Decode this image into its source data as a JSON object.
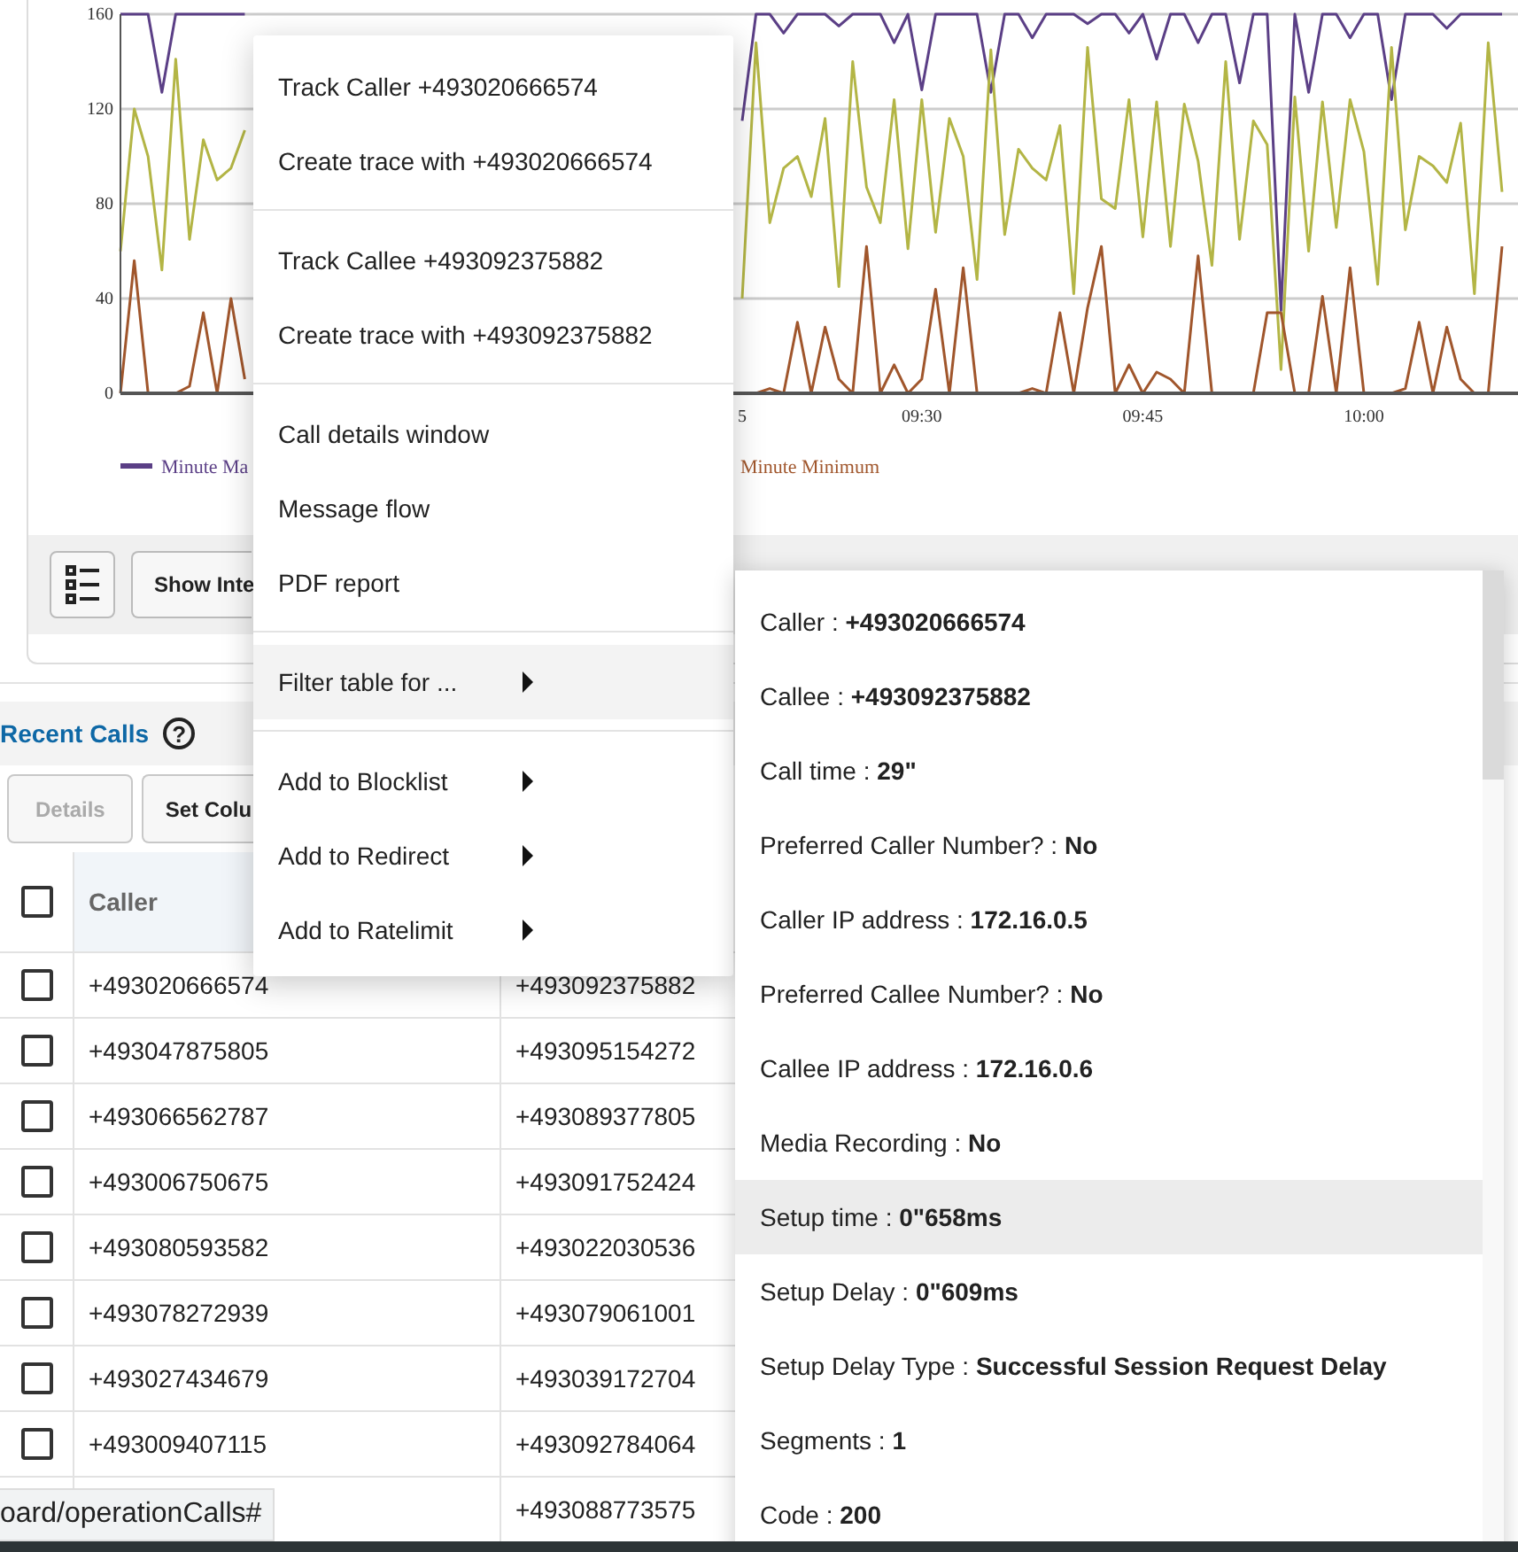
{
  "chart_card": {
    "chart_data": {
      "type": "line",
      "grid": true,
      "ylim": [
        0,
        160
      ],
      "yticks": [
        0,
        40,
        80,
        120,
        160
      ],
      "categories": [
        null,
        null,
        null,
        null,
        null,
        null,
        null,
        null,
        null,
        null,
        null,
        null,
        null,
        null,
        null,
        null,
        null,
        null,
        null,
        null,
        null,
        null,
        null,
        null,
        null,
        null,
        null,
        null,
        null,
        null,
        null,
        null,
        null,
        null,
        null,
        null,
        null,
        null,
        null,
        null,
        null,
        null,
        null,
        null,
        null,
        "5",
        null,
        null,
        null,
        null,
        null,
        null,
        null,
        null,
        null,
        null,
        null,
        null,
        "09:30",
        null,
        null,
        null,
        null,
        null,
        null,
        null,
        null,
        null,
        null,
        null,
        null,
        null,
        null,
        null,
        "09:45",
        null,
        null,
        null,
        null,
        null,
        null,
        null,
        null,
        null,
        null,
        null,
        null,
        null,
        null,
        null,
        "10:00",
        null,
        null,
        null,
        null,
        null,
        null,
        null,
        null,
        null,
        null
      ],
      "series": [
        {
          "name": "Minute Ma",
          "color": "#5b3f86",
          "values": [
            160,
            160,
            160,
            127,
            160,
            160,
            160,
            160,
            160,
            160,
            null,
            null,
            null,
            null,
            null,
            null,
            null,
            null,
            null,
            null,
            null,
            null,
            null,
            null,
            null,
            null,
            null,
            null,
            null,
            null,
            null,
            null,
            null,
            null,
            null,
            null,
            null,
            null,
            null,
            null,
            null,
            null,
            null,
            null,
            null,
            115,
            160,
            160,
            152,
            160,
            160,
            160,
            155,
            160,
            160,
            160,
            148,
            160,
            128,
            160,
            160,
            160,
            160,
            127,
            160,
            160,
            150,
            160,
            160,
            160,
            156,
            160,
            160,
            152,
            160,
            141,
            160,
            160,
            148,
            160,
            160,
            131,
            160,
            160,
            35,
            160,
            127,
            160,
            160,
            150,
            160,
            160,
            124,
            160,
            160,
            160,
            154,
            160,
            160,
            160,
            160
          ]
        },
        {
          "color": "#b3b545",
          "values": [
            60,
            120,
            100,
            52,
            141,
            65,
            107,
            90,
            95,
            111,
            null,
            null,
            null,
            null,
            null,
            null,
            null,
            null,
            null,
            null,
            null,
            null,
            null,
            null,
            null,
            null,
            null,
            null,
            null,
            null,
            null,
            null,
            null,
            null,
            null,
            null,
            null,
            null,
            null,
            null,
            null,
            null,
            null,
            null,
            null,
            40,
            148,
            72,
            95,
            100,
            83,
            116,
            45,
            140,
            87,
            72,
            124,
            61,
            124,
            68,
            116,
            100,
            48,
            145,
            67,
            103,
            95,
            90,
            113,
            42,
            146,
            82,
            78,
            124,
            66,
            123,
            62,
            122,
            98,
            54,
            140,
            65,
            115,
            105,
            10,
            125,
            60,
            123,
            70,
            124,
            102,
            46,
            146,
            69,
            100,
            96,
            89,
            114,
            42,
            148,
            85
          ]
        },
        {
          "name": "Minute Minimum",
          "color": "#a0562c",
          "values": [
            0,
            56,
            0,
            0,
            0,
            3,
            34,
            0,
            40,
            6,
            null,
            null,
            null,
            null,
            null,
            null,
            null,
            null,
            null,
            null,
            null,
            null,
            null,
            null,
            null,
            null,
            null,
            null,
            null,
            null,
            null,
            null,
            null,
            null,
            null,
            null,
            null,
            null,
            null,
            null,
            null,
            null,
            null,
            null,
            null,
            0,
            0,
            2,
            0,
            30,
            0,
            28,
            6,
            0,
            62,
            0,
            12,
            0,
            6,
            44,
            0,
            53,
            0,
            0,
            0,
            0,
            2,
            0,
            34,
            0,
            36,
            62,
            0,
            12,
            0,
            9,
            6,
            0,
            58,
            0,
            0,
            0,
            0,
            34,
            34,
            0,
            0,
            41,
            0,
            53,
            0,
            0,
            0,
            2,
            30,
            0,
            28,
            6,
            0,
            0,
            62
          ]
        }
      ]
    },
    "toolbar": [
      {
        "kind": "icon"
      },
      {
        "kind": "text",
        "label": "Show Inte"
      }
    ]
  },
  "recent_calls": {
    "title": "Recent Calls",
    "help": "?",
    "buttons": [
      {
        "label": "Details",
        "disabled": true
      },
      {
        "label": "Set Colu",
        "disabled": false
      }
    ],
    "table": {
      "header_checked": false,
      "columns": [
        "Caller"
      ],
      "rows": [
        {
          "checked": false,
          "caller": "+493020666574",
          "callee": "+493092375882"
        },
        {
          "checked": false,
          "caller": "+493047875805",
          "callee": "+493095154272"
        },
        {
          "checked": false,
          "caller": "+493066562787",
          "callee": "+493089377805"
        },
        {
          "checked": false,
          "caller": "+493006750675",
          "callee": "+493091752424"
        },
        {
          "checked": false,
          "caller": "+493080593582",
          "callee": "+493022030536"
        },
        {
          "checked": false,
          "caller": "+493078272939",
          "callee": "+493079061001"
        },
        {
          "checked": false,
          "caller": "+493027434679",
          "callee": "+493039172704"
        },
        {
          "checked": false,
          "caller": "+493009407115",
          "callee": "+493092784064"
        },
        {
          "callee": "+493088773575"
        }
      ]
    }
  },
  "context_menu": {
    "sections": [
      [
        {
          "label": "Track Caller +493020666574",
          "submenu": false,
          "selected": false
        },
        {
          "label": "Create trace with +493020666574",
          "submenu": false,
          "selected": false
        }
      ],
      [
        {
          "label": "Track Callee +493092375882",
          "submenu": false,
          "selected": false
        },
        {
          "label": "Create trace with +493092375882",
          "submenu": false,
          "selected": false
        }
      ],
      [
        {
          "label": "Call details window",
          "submenu": false,
          "selected": false
        },
        {
          "label": "Message flow",
          "submenu": false,
          "selected": false
        },
        {
          "label": "PDF report",
          "submenu": false,
          "selected": false
        }
      ],
      [
        {
          "label": "Filter table for ...",
          "submenu": true,
          "selected": true
        }
      ],
      [
        {
          "label": "Add to Blocklist",
          "submenu": true,
          "selected": false
        },
        {
          "label": "Add to Redirect",
          "submenu": true,
          "selected": false
        },
        {
          "label": "Add to Ratelimit",
          "submenu": true,
          "selected": false
        }
      ]
    ]
  },
  "details_popup": {
    "rows": [
      {
        "text": "Caller : **+493020666574**",
        "selected": false
      },
      {
        "text": "Callee : **+493092375882**",
        "selected": false
      },
      {
        "text": "Call time : **29\"**",
        "selected": false
      },
      {
        "text": "Preferred Caller Number? : **No**",
        "selected": false
      },
      {
        "text": "Caller IP address : **172.16.0.5**",
        "selected": false
      },
      {
        "text": "Preferred Callee Number? : **No**",
        "selected": false
      },
      {
        "text": "Callee IP address : **172.16.0.6**",
        "selected": false
      },
      {
        "text": "Media Recording : **No**",
        "selected": false
      },
      {
        "text": "Setup time : **0\"658ms**",
        "selected": true
      },
      {
        "text": "Setup Delay : **0\"609ms**",
        "selected": false
      },
      {
        "text": "Setup Delay Type : **Successful Session Request Delay**",
        "selected": false
      },
      {
        "text": "Segments : **1**",
        "selected": false
      },
      {
        "text": "Code : **200**",
        "selected": false
      }
    ]
  },
  "status_url": "oard/operationCalls#"
}
